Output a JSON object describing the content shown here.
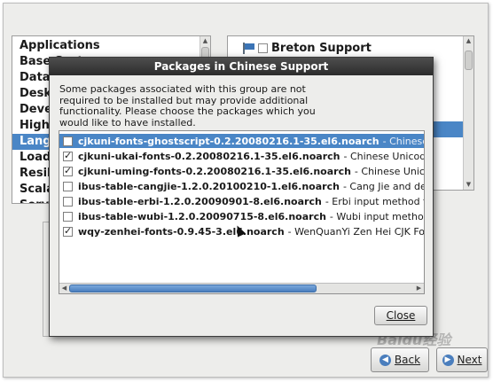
{
  "categories": {
    "items": [
      "Applications",
      "Base System",
      "Databases",
      "Desktops",
      "Development",
      "High Availability",
      "Languages",
      "Load Balancer",
      "Resilient Storage",
      "Scalable Filesystem",
      "Servers"
    ],
    "selected_index": 6
  },
  "groups": {
    "visible_label": "Breton Support"
  },
  "dialog": {
    "title": "Packages in Chinese Support",
    "description": "Some packages associated with this group are not required to be installed but may provide additional functionality.  Please choose the packages which you would like to have installed.",
    "packages": [
      {
        "name": "cjkuni-fonts-ghostscript-0.2.20080216.1-35.el6.noarch",
        "desc": "- Chinese Unicode TrueType",
        "checked": false,
        "selected": true
      },
      {
        "name": "cjkuni-ukai-fonts-0.2.20080216.1-35.el6.noarch",
        "desc": "- Chinese Unicode TrueType font",
        "checked": true,
        "selected": false
      },
      {
        "name": "cjkuni-uming-fonts-0.2.20080216.1-35.el6.noarch",
        "desc": "- Chinese Unicode TrueType",
        "checked": true,
        "selected": false
      },
      {
        "name": "ibus-table-cangjie-1.2.0.20100210-1.el6.noarch",
        "desc": "- Cang Jie and derived tables",
        "checked": false,
        "selected": false
      },
      {
        "name": "ibus-table-erbi-1.2.0.20090901-8.el6.noarch",
        "desc": "- Erbi input method tables for IBus",
        "checked": false,
        "selected": false
      },
      {
        "name": "ibus-table-wubi-1.2.0.20090715-8.el6.noarch",
        "desc": "- Wubi input methods for ibus-table",
        "checked": false,
        "selected": false
      },
      {
        "name": "wqy-zenhei-fonts-0.9.45-3.el6.noarch",
        "desc": "- WenQuanYi Zen Hei CJK Font",
        "checked": true,
        "selected": false
      }
    ],
    "close_label": "Close",
    "hscroll_fraction": 0.72
  },
  "nav": {
    "back_label": "Back",
    "next_label": "Next"
  },
  "watermark": "Baidu经验"
}
